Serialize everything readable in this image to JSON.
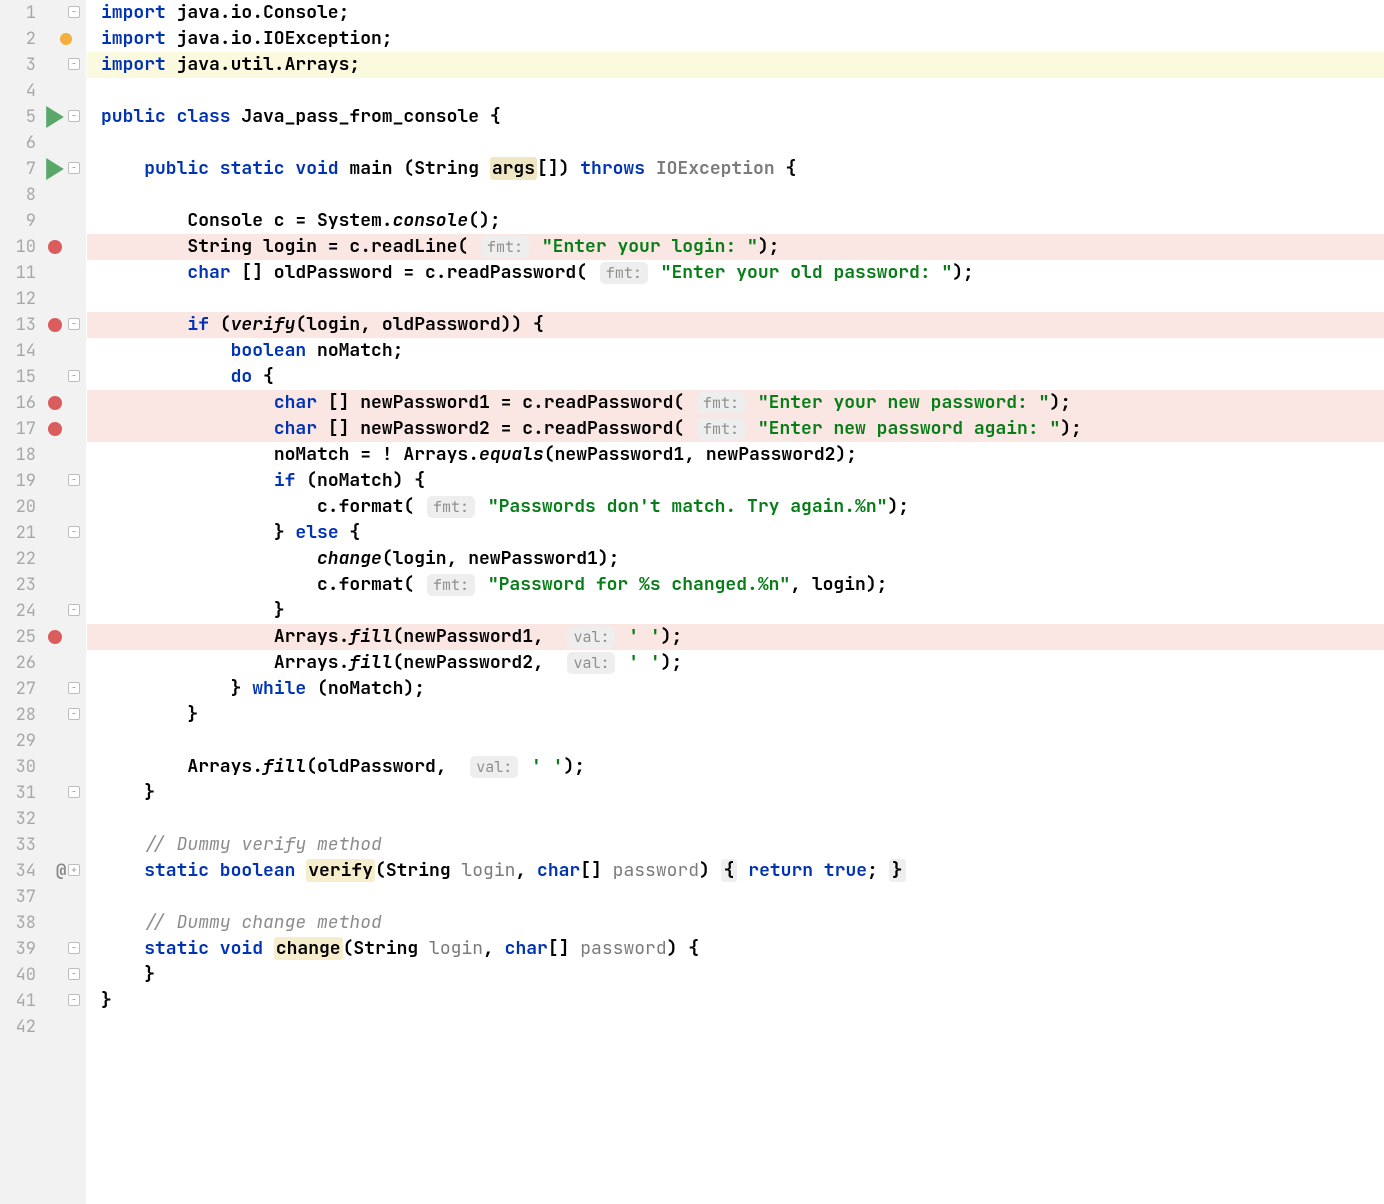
{
  "hints": {
    "fmt": "fmt:",
    "val": "val:"
  },
  "strings": {
    "enter_login": "\"Enter your login: \"",
    "enter_old_pw": "\"Enter your old password: \"",
    "enter_new_pw": "\"Enter your new password: \"",
    "enter_new_pw2": "\"Enter new password again: \"",
    "no_match": "\"Passwords don't match. Try again.%n\"",
    "changed": "\"Password for %s changed.%n\"",
    "space_char": "' '"
  },
  "comments": {
    "dummy_verify": "// Dummy verify method",
    "dummy_change": "// Dummy change method"
  },
  "lines": [
    {
      "n": 1,
      "collapse": "minus-top",
      "tokens": [
        [
          "kw",
          "import "
        ],
        [
          "normal",
          "java.io.Console;"
        ]
      ]
    },
    {
      "n": 2,
      "warn": true,
      "tokens": [
        [
          "kw",
          "import "
        ],
        [
          "normal",
          "java.io.IOException;"
        ]
      ]
    },
    {
      "n": 3,
      "hl": "yellow",
      "collapse": "minus-bot",
      "tokens": [
        [
          "kw",
          "import "
        ],
        [
          "normal",
          "java.util.Arrays;"
        ]
      ]
    },
    {
      "n": 4,
      "tokens": []
    },
    {
      "n": 5,
      "run": true,
      "collapse": "minus-top",
      "tokens": [
        [
          "kw",
          "public class "
        ],
        [
          "cls",
          "Java_pass_from_console "
        ],
        [
          "normal",
          "{"
        ]
      ]
    },
    {
      "n": 6,
      "tokens": []
    },
    {
      "n": 7,
      "run": true,
      "collapse": "minus-top",
      "indent": 1,
      "tokens": [
        [
          "kw",
          "public static void "
        ],
        [
          "normal",
          "main (String "
        ],
        [
          "highlight-box",
          "args"
        ],
        [
          "normal",
          "[]) "
        ],
        [
          "kw",
          "throws "
        ],
        [
          "param-gray",
          "IOException "
        ],
        [
          "normal",
          "{"
        ]
      ]
    },
    {
      "n": 8,
      "tokens": []
    },
    {
      "n": 9,
      "indent": 2,
      "tokens": [
        [
          "normal",
          "Console c = System."
        ],
        [
          "method-italic",
          "console"
        ],
        [
          "normal",
          "();"
        ]
      ]
    },
    {
      "n": 10,
      "breakpoint": true,
      "indent": 2,
      "tokens": [
        [
          "normal",
          "String login = c.readLine( "
        ],
        [
          "hint",
          "fmt"
        ],
        [
          "normal",
          " "
        ],
        [
          "string",
          "\"Enter your login: \""
        ],
        [
          "normal",
          ");"
        ]
      ]
    },
    {
      "n": 11,
      "indent": 2,
      "tokens": [
        [
          "kw",
          "char "
        ],
        [
          "normal",
          "[] oldPassword = c.readPassword( "
        ],
        [
          "hint",
          "fmt"
        ],
        [
          "normal",
          " "
        ],
        [
          "string",
          "\"Enter your old password: \""
        ],
        [
          "normal",
          ");"
        ]
      ]
    },
    {
      "n": 12,
      "tokens": []
    },
    {
      "n": 13,
      "breakpoint": true,
      "collapse": "minus-top",
      "indent": 2,
      "tokens": [
        [
          "kw",
          "if "
        ],
        [
          "normal",
          "("
        ],
        [
          "method-italic",
          "verify"
        ],
        [
          "normal",
          "(login, oldPassword)) {"
        ]
      ]
    },
    {
      "n": 14,
      "indent": 3,
      "tokens": [
        [
          "kw",
          "boolean "
        ],
        [
          "normal",
          "noMatch;"
        ]
      ]
    },
    {
      "n": 15,
      "collapse": "minus-top",
      "indent": 3,
      "tokens": [
        [
          "kw",
          "do "
        ],
        [
          "normal",
          "{"
        ]
      ]
    },
    {
      "n": 16,
      "breakpoint": true,
      "indent": 4,
      "tokens": [
        [
          "kw",
          "char "
        ],
        [
          "normal",
          "[] newPassword1 = c.readPassword( "
        ],
        [
          "hint",
          "fmt"
        ],
        [
          "normal",
          " "
        ],
        [
          "string",
          "\"Enter your new password: \""
        ],
        [
          "normal",
          ");"
        ]
      ]
    },
    {
      "n": 17,
      "breakpoint": true,
      "indent": 4,
      "tokens": [
        [
          "kw",
          "char "
        ],
        [
          "normal",
          "[] newPassword2 = c.readPassword( "
        ],
        [
          "hint",
          "fmt"
        ],
        [
          "normal",
          " "
        ],
        [
          "string",
          "\"Enter new password again: \""
        ],
        [
          "normal",
          ");"
        ]
      ]
    },
    {
      "n": 18,
      "indent": 4,
      "tokens": [
        [
          "normal",
          "noMatch = ! Arrays."
        ],
        [
          "method-italic",
          "equals"
        ],
        [
          "normal",
          "(newPassword1, newPassword2);"
        ]
      ]
    },
    {
      "n": 19,
      "collapse": "minus-top",
      "indent": 4,
      "tokens": [
        [
          "kw",
          "if "
        ],
        [
          "normal",
          "(noMatch) {"
        ]
      ]
    },
    {
      "n": 20,
      "indent": 5,
      "tokens": [
        [
          "normal",
          "c.format( "
        ],
        [
          "hint",
          "fmt"
        ],
        [
          "normal",
          " "
        ],
        [
          "string",
          "\"Passwords don't match. Try again.%n\""
        ],
        [
          "normal",
          ");"
        ]
      ]
    },
    {
      "n": 21,
      "collapse": "minus-mid",
      "indent": 4,
      "tokens": [
        [
          "normal",
          "} "
        ],
        [
          "kw",
          "else "
        ],
        [
          "normal",
          "{"
        ]
      ]
    },
    {
      "n": 22,
      "indent": 5,
      "tokens": [
        [
          "method-italic",
          "change"
        ],
        [
          "normal",
          "(login, newPassword1);"
        ]
      ]
    },
    {
      "n": 23,
      "indent": 5,
      "tokens": [
        [
          "normal",
          "c.format( "
        ],
        [
          "hint",
          "fmt"
        ],
        [
          "normal",
          " "
        ],
        [
          "string",
          "\"Password for %s changed.%n\""
        ],
        [
          "normal",
          ", login);"
        ]
      ]
    },
    {
      "n": 24,
      "collapse": "minus-bot",
      "indent": 4,
      "tokens": [
        [
          "normal",
          "}"
        ]
      ]
    },
    {
      "n": 25,
      "breakpoint": true,
      "indent": 4,
      "tokens": [
        [
          "normal",
          "Arrays."
        ],
        [
          "method-italic",
          "fill"
        ],
        [
          "normal",
          "(newPassword1,  "
        ],
        [
          "hint",
          "val"
        ],
        [
          "normal",
          " "
        ],
        [
          "string",
          "' '"
        ],
        [
          "normal",
          ");"
        ]
      ]
    },
    {
      "n": 26,
      "indent": 4,
      "tokens": [
        [
          "normal",
          "Arrays."
        ],
        [
          "method-italic",
          "fill"
        ],
        [
          "normal",
          "(newPassword2,  "
        ],
        [
          "hint",
          "val"
        ],
        [
          "normal",
          " "
        ],
        [
          "string",
          "' '"
        ],
        [
          "normal",
          ");"
        ]
      ]
    },
    {
      "n": 27,
      "collapse": "minus-bot",
      "indent": 3,
      "tokens": [
        [
          "normal",
          "} "
        ],
        [
          "kw",
          "while "
        ],
        [
          "normal",
          "(noMatch);"
        ]
      ]
    },
    {
      "n": 28,
      "collapse": "minus-bot",
      "indent": 2,
      "tokens": [
        [
          "normal",
          "}"
        ]
      ]
    },
    {
      "n": 29,
      "tokens": []
    },
    {
      "n": 30,
      "indent": 2,
      "tokens": [
        [
          "normal",
          "Arrays."
        ],
        [
          "method-italic",
          "fill"
        ],
        [
          "normal",
          "(oldPassword,  "
        ],
        [
          "hint",
          "val"
        ],
        [
          "normal",
          " "
        ],
        [
          "string",
          "' '"
        ],
        [
          "normal",
          ");"
        ]
      ]
    },
    {
      "n": 31,
      "collapse": "minus-bot",
      "indent": 1,
      "tokens": [
        [
          "normal",
          "}"
        ]
      ]
    },
    {
      "n": 32,
      "tokens": []
    },
    {
      "n": 33,
      "indent": 1,
      "tokens": [
        [
          "comment",
          "// Dummy verify method"
        ]
      ]
    },
    {
      "n": 34,
      "override": true,
      "collapse": "plus",
      "indent": 1,
      "tokens": [
        [
          "kw",
          "static boolean "
        ],
        [
          "highlight-box-d",
          "verify"
        ],
        [
          "normal",
          "(String "
        ],
        [
          "param-gray-nf",
          "login"
        ],
        [
          "normal",
          ", "
        ],
        [
          "kw",
          "char"
        ],
        [
          "normal",
          "[] "
        ],
        [
          "param-gray-nf",
          "password"
        ],
        [
          "normal",
          ") "
        ],
        [
          "brace-dim",
          "{"
        ],
        [
          "normal",
          " "
        ],
        [
          "kw",
          "return true"
        ],
        [
          "normal",
          "; "
        ],
        [
          "brace-dim",
          "}"
        ]
      ]
    },
    {
      "n": 37,
      "tokens": []
    },
    {
      "n": 38,
      "indent": 1,
      "tokens": [
        [
          "comment",
          "// Dummy change method"
        ]
      ]
    },
    {
      "n": 39,
      "collapse": "minus-top",
      "indent": 1,
      "tokens": [
        [
          "kw",
          "static void "
        ],
        [
          "highlight-box-d",
          "change"
        ],
        [
          "normal",
          "(String "
        ],
        [
          "param-gray-nf",
          "login"
        ],
        [
          "normal",
          ", "
        ],
        [
          "kw",
          "char"
        ],
        [
          "normal",
          "[] "
        ],
        [
          "param-gray-nf",
          "password"
        ],
        [
          "normal",
          ") {"
        ]
      ]
    },
    {
      "n": 40,
      "collapse": "minus-bot",
      "indent": 1,
      "tokens": [
        [
          "normal",
          "}"
        ]
      ]
    },
    {
      "n": 41,
      "collapse": "minus-bot",
      "tokens": [
        [
          "normal",
          "}"
        ]
      ]
    },
    {
      "n": 42,
      "tokens": []
    }
  ]
}
